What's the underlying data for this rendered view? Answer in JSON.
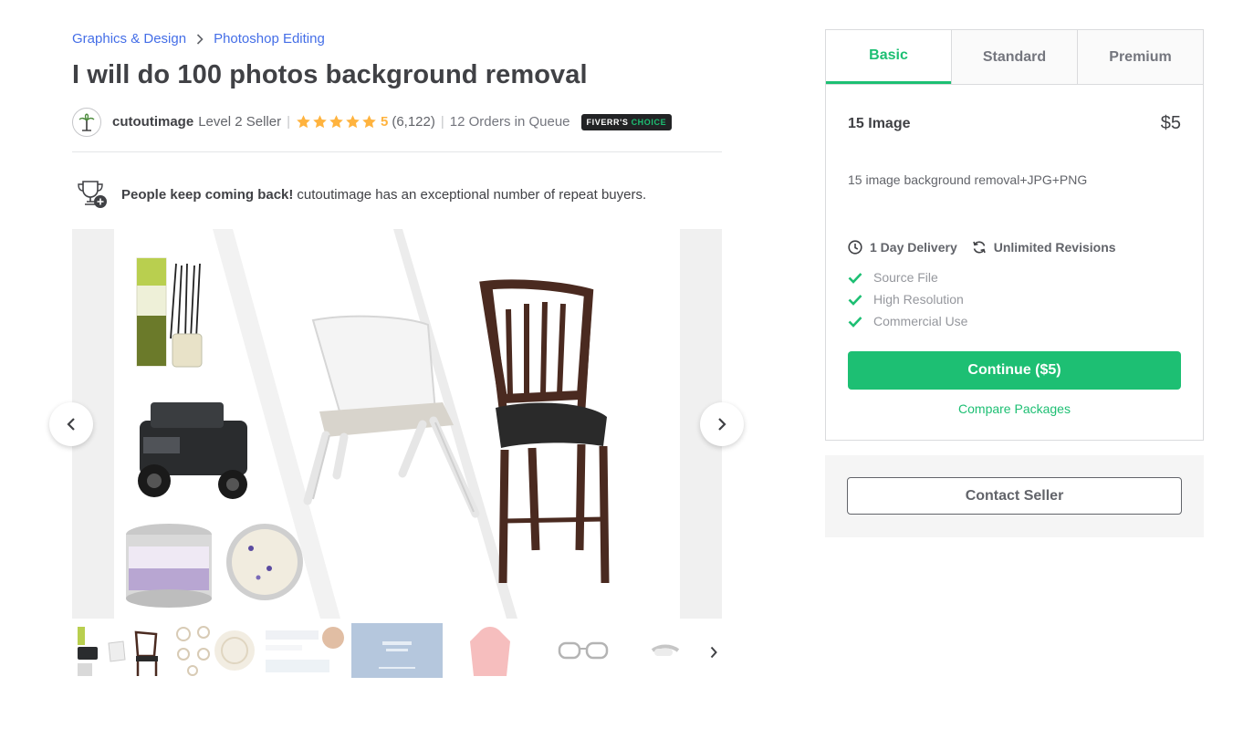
{
  "breadcrumb": {
    "items": [
      "Graphics & Design",
      "Photoshop Editing"
    ]
  },
  "gig": {
    "title": "I will do 100 photos background removal"
  },
  "seller": {
    "name": "cutoutimage",
    "level": "Level 2 Seller",
    "rating": "5",
    "stars": 5,
    "reviews": "(6,122)",
    "queue": "12 Orders in Queue",
    "badge_prefix": "FIVERR'S",
    "badge_suffix": "CHOICE"
  },
  "repeat_buyers": {
    "bold": "People keep coming back!",
    "text": "cutoutimage has an exceptional number of repeat buyers."
  },
  "gallery": {
    "thumbnails": 8,
    "active_thumbnail": 1
  },
  "package": {
    "tabs": [
      "Basic",
      "Standard",
      "Premium"
    ],
    "active_tab": "Basic",
    "name": "15 Image",
    "price": "$5",
    "description": "15 image background removal+JPG+PNG",
    "delivery": "1 Day Delivery",
    "revisions": "Unlimited Revisions",
    "features": [
      "Source File",
      "High Resolution",
      "Commercial Use"
    ],
    "continue_label": "Continue ($5)",
    "compare_label": "Compare Packages"
  },
  "contact": {
    "label": "Contact Seller"
  },
  "colors": {
    "accent_green": "#1dbf73",
    "link_blue": "#446ee7",
    "star_yellow": "#ffb33e"
  }
}
